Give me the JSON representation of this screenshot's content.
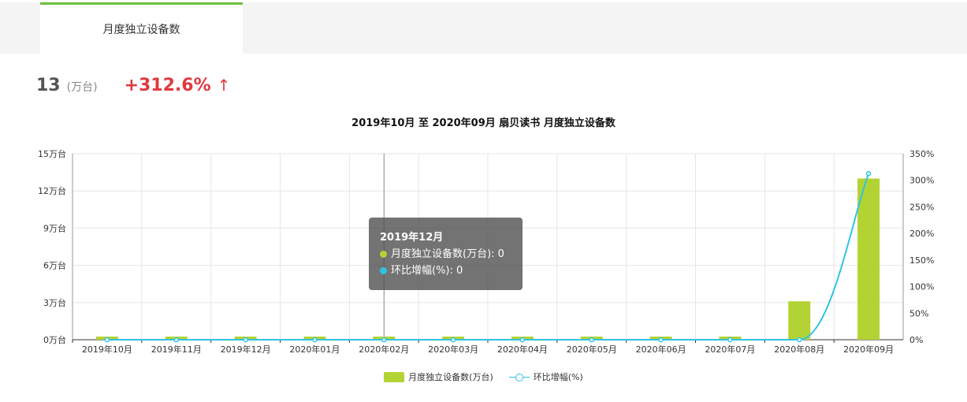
{
  "tabs": [
    {
      "label": "月度独立设备数"
    }
  ],
  "kpi": {
    "value": "13",
    "unit": "(万台)",
    "change": "+312.6%",
    "arrow": "↑"
  },
  "chart_data": {
    "type": "bar",
    "title": "2019年10月 至 2020年09月 扇贝读书 月度独立设备数",
    "categories": [
      "2019年10月",
      "2019年11月",
      "2019年12月",
      "2020年01月",
      "2020年02月",
      "2020年03月",
      "2020年04月",
      "2020年05月",
      "2020年06月",
      "2020年07月",
      "2020年08月",
      "2020年09月"
    ],
    "series": [
      {
        "name": "月度独立设备数(万台)",
        "type": "bar",
        "axis": "left",
        "color": "#b3d334",
        "values": [
          0,
          0,
          0,
          0,
          0,
          0,
          0,
          0,
          0,
          0,
          3.1,
          13
        ]
      },
      {
        "name": "环比增幅(%)",
        "type": "line",
        "axis": "right",
        "color": "#2fc3e3",
        "values": [
          0,
          0,
          0,
          0,
          0,
          0,
          0,
          0,
          0,
          0,
          0,
          312.6
        ]
      }
    ],
    "y_left": {
      "ylim": [
        0,
        15
      ],
      "ticks": [
        "0万台",
        "3万台",
        "6万台",
        "9万台",
        "12万台",
        "15万台"
      ]
    },
    "y_right": {
      "ylim": [
        0,
        350
      ],
      "ticks": [
        "0%",
        "50%",
        "100%",
        "150%",
        "200%",
        "250%",
        "300%",
        "350%"
      ]
    },
    "grid": true,
    "legend_position": "bottom",
    "tooltip": {
      "title": "2019年12月",
      "rows": [
        {
          "label": "月度独立设备数(万台): 0",
          "color": "#b3d334"
        },
        {
          "label": "环比增幅(%): 0",
          "color": "#2fc3e3"
        }
      ]
    }
  }
}
